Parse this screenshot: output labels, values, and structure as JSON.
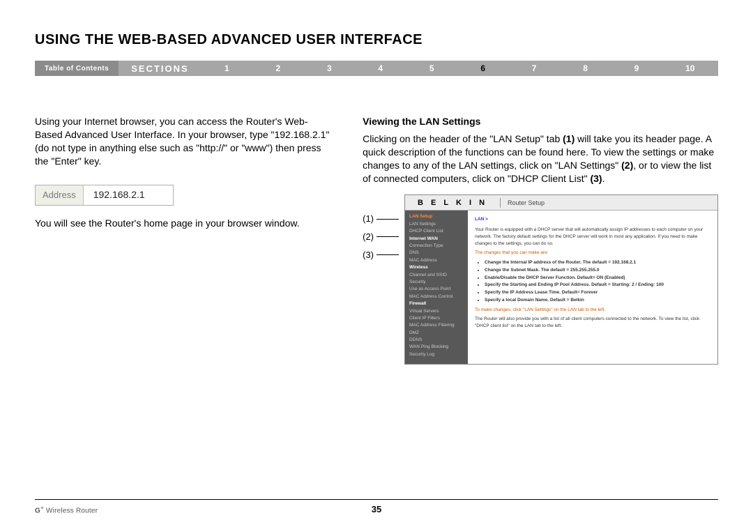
{
  "title": "USING THE WEB-BASED ADVANCED USER INTERFACE",
  "nav": {
    "toc": "Table of Contents",
    "sections": "SECTIONS",
    "items": [
      "1",
      "2",
      "3",
      "4",
      "5",
      "6",
      "7",
      "8",
      "9",
      "10"
    ],
    "active": "6"
  },
  "left": {
    "p1": "Using your Internet browser, you can access the Router's Web-Based Advanced User Interface. In your browser, type \"192.168.2.1\" (do not type in anything else such as \"http://\" or \"www\") then press the \"Enter\" key.",
    "addr_label": "Address",
    "addr_value": "192.168.2.1",
    "p2": "You will see the Router's home page in your browser window."
  },
  "right": {
    "heading": "Viewing the LAN Settings",
    "p1_a": "Clicking on the header of the \"LAN Setup\" tab ",
    "p1_b": "(1)",
    "p1_c": " will take you its header page. A quick description of the functions can be found here. To view the settings or make changes to any of the LAN settings, click on \"LAN Settings\" ",
    "p1_d": "(2)",
    "p1_e": ", or to view the list of connected computers, click on \"DHCP Client List\" ",
    "p1_f": "(3)",
    "p1_g": "."
  },
  "callouts": {
    "c1": "(1)",
    "c2": "(2)",
    "c3": "(3)"
  },
  "shot": {
    "brand": "B E L K I N",
    "route": "Router Setup",
    "crumb": "LAN >",
    "sidebar": {
      "lan_setup": "LAN Setup",
      "lan_settings": "LAN Settings",
      "dhcp_client": "DHCP Client List",
      "internet_wan": "Internet WAN",
      "conn_type": "Connection Type",
      "dns": "DNS",
      "mac_address": "MAC Address",
      "wireless": "Wireless",
      "channel_ssid": "Channel and SSID",
      "security": "Security",
      "use_ap": "Use as Access Point",
      "mac_ctrl": "MAC Address Control",
      "firewall": "Firewall",
      "virtual_servers": "Virtual Servers",
      "client_filters": "Client IP Filters",
      "mac_filtering": "MAC Address Filtering",
      "dmz": "DMZ",
      "ddns": "DDNS",
      "wan_ping": "WAN Ping Blocking",
      "security_log": "Security Log"
    },
    "main": {
      "intro": "Your Router is equipped with a DHCP server that will automatically assign IP addresses to each computer on your network. The factory default settings for the DHCP server will work in most any application. If you need to make changes to the settings, you can do so.",
      "changes_header": "The changes that you can make are:",
      "b1": "Change the Internal IP address of the Router. The default = 192.168.2.1",
      "b2": "Change the Subnet Mask. The default = 255.255.255.0",
      "b3": "Enable/Disable the DHCP Server Function. Default= ON (Enabled)",
      "b4": "Specify the Starting and Ending IP Pool Address. Default = Starting: 2 / Ending: 100",
      "b5": "Specify the IP Address Lease Time. Default= Forever",
      "b6": "Specify a local Domain Name. Default = Belkin",
      "apply": "To make changes, click \"LAN Settings\" on the LAN tab to the left.",
      "client_list": "The Router will also provide you with a list of all client computers connected to the network. To view the list, click \"DHCP client list\" on the LAN tab to the left."
    }
  },
  "footer": {
    "product_a": "G",
    "product_b": " Wireless Router",
    "page": "35"
  }
}
